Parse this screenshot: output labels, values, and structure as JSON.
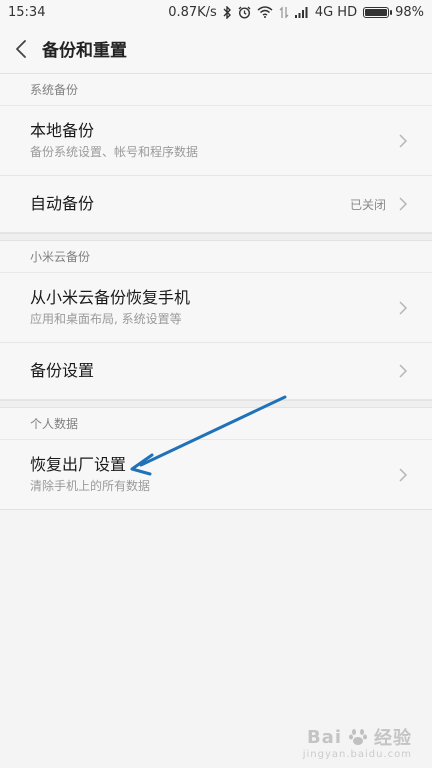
{
  "status_bar": {
    "time": "15:34",
    "speed": "0.87K/s",
    "network": "4G HD",
    "battery": "98%",
    "battery_level": 0.98,
    "icons": [
      "bluetooth-icon",
      "alarm-icon",
      "wifi-icon",
      "data-transfer-icon",
      "signal-icon"
    ]
  },
  "header": {
    "title": "备份和重置"
  },
  "sections": [
    {
      "header": "系统备份",
      "items": [
        {
          "title": "本地备份",
          "subtitle": "备份系统设置、帐号和程序数据",
          "value": ""
        },
        {
          "title": "自动备份",
          "subtitle": "",
          "value": "已关闭"
        }
      ]
    },
    {
      "header": "小米云备份",
      "items": [
        {
          "title": "从小米云备份恢复手机",
          "subtitle": "应用和桌面布局, 系统设置等",
          "value": ""
        },
        {
          "title": "备份设置",
          "subtitle": "",
          "value": ""
        }
      ]
    },
    {
      "header": "个人数据",
      "items": [
        {
          "title": "恢复出厂设置",
          "subtitle": "清除手机上的所有数据",
          "value": ""
        }
      ]
    }
  ],
  "annotation": {
    "color": "#1f72b8"
  },
  "watermark": {
    "brand": "Bai",
    "brand_suffix": "经验",
    "sub": "jingyan.baidu.com"
  }
}
